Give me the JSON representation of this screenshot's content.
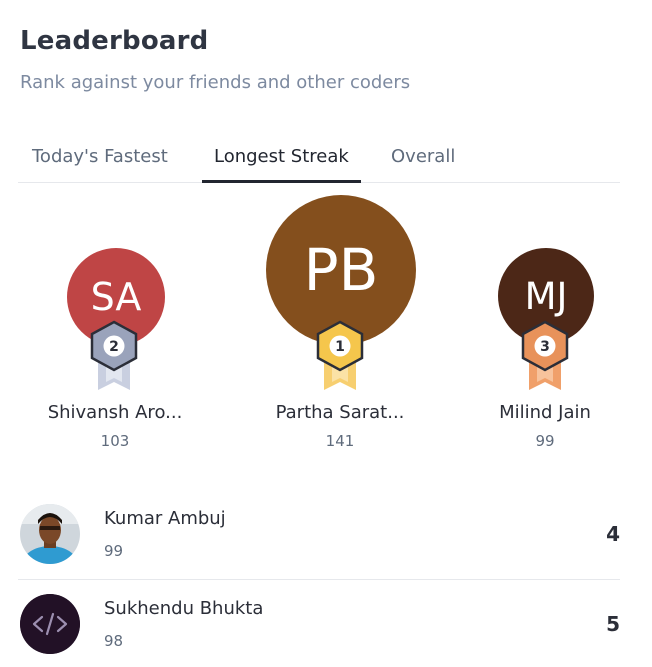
{
  "header": {
    "title": "Leaderboard",
    "subtitle": "Rank against your friends and other coders"
  },
  "tabs": [
    {
      "label": "Today's Fastest",
      "active": false
    },
    {
      "label": "Longest Streak",
      "active": true
    },
    {
      "label": "Overall",
      "active": false
    }
  ],
  "podium": [
    {
      "rank": "2",
      "initials": "SA",
      "name": "Shivansh Aro...",
      "score": "103",
      "avatar_color": "#bf4545",
      "medal": "silver-medal-icon"
    },
    {
      "rank": "1",
      "initials": "PB",
      "name": "Partha Sarat...",
      "score": "141",
      "avatar_color": "#844f1d",
      "medal": "gold-medal-icon"
    },
    {
      "rank": "3",
      "initials": "MJ",
      "name": "Milind Jain",
      "score": "99",
      "avatar_color": "#4c2717",
      "medal": "bronze-medal-icon"
    }
  ],
  "list": [
    {
      "name": "Kumar Ambuj",
      "score": "99",
      "rank": "4",
      "avatar": "profile-photo"
    },
    {
      "name": "Sukhendu Bhukta",
      "score": "98",
      "rank": "5",
      "avatar": "code-icon"
    }
  ],
  "colors": {
    "gold": "#f5c64c",
    "silver": "#aeb6cc",
    "bronze": "#e8925a",
    "accent_text": "#222630",
    "muted_text": "#7d8aa0"
  }
}
